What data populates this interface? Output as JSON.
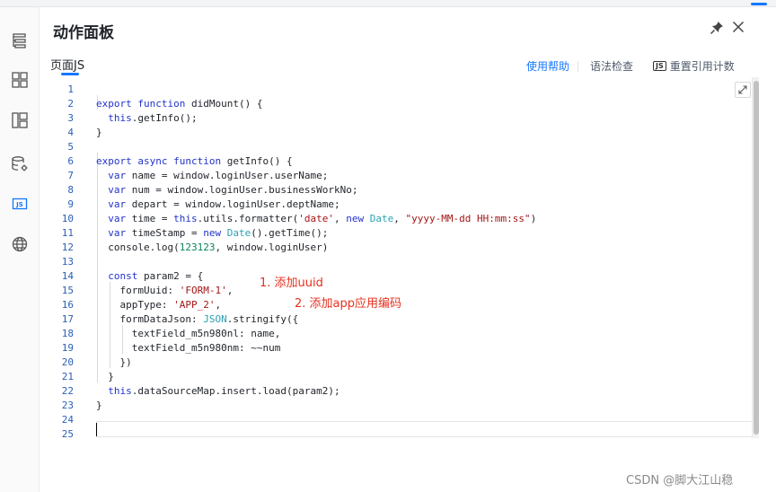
{
  "panel": {
    "title": "动作面板",
    "tab": "页面JS",
    "toolbar": {
      "help": "使用帮助",
      "lint": "语法检查",
      "reset_badge": "JS",
      "reset": "重置引用计数"
    }
  },
  "sidebar": {
    "items": [
      {
        "icon": "outline-tree-icon"
      },
      {
        "icon": "components-grid-icon"
      },
      {
        "icon": "layout-icon"
      },
      {
        "icon": "datasource-settings-icon"
      },
      {
        "icon": "js-icon",
        "label": "JS",
        "active": true
      },
      {
        "icon": "globe-icon"
      }
    ]
  },
  "editor": {
    "line_numbers": [
      "1",
      "2",
      "3",
      "4",
      "5",
      "6",
      "7",
      "8",
      "9",
      "10",
      "11",
      "12",
      "13",
      "14",
      "15",
      "16",
      "17",
      "18",
      "19",
      "20",
      "21",
      "22",
      "23",
      "24",
      "25"
    ],
    "lines": [
      "",
      "export function didMount() {",
      "  this.getInfo();",
      "}",
      "",
      "export async function getInfo() {",
      "  var name = window.loginUser.userName;",
      "  var num = window.loginUser.businessWorkNo;",
      "  var depart = window.loginUser.deptName;",
      "  var time = this.utils.formatter('date', new Date, \"yyyy-MM-dd HH:mm:ss\")",
      "  var timeStamp = new Date().getTime();",
      "  console.log(123123, window.loginUser)",
      "",
      "  const param2 = {",
      "    formUuid: 'FORM-1',",
      "    appType: 'APP_2',",
      "    formDataJson: JSON.stringify({",
      "      textField_m5n980nl: name,",
      "      textField_m5n980nm: ~~num",
      "    })",
      "  }",
      "  this.dataSourceMap.insert.load(param2);",
      "}",
      "",
      ""
    ]
  },
  "annotations": {
    "a1": "1. 添加uuid",
    "a2": "2. 添加app应用编码"
  },
  "watermark": "CSDN @脚大江山稳",
  "colors": {
    "accent": "#1677ff",
    "keyword": "#2233cc",
    "string": "#a31515",
    "number": "#098658",
    "annotation": "#e8301d"
  }
}
